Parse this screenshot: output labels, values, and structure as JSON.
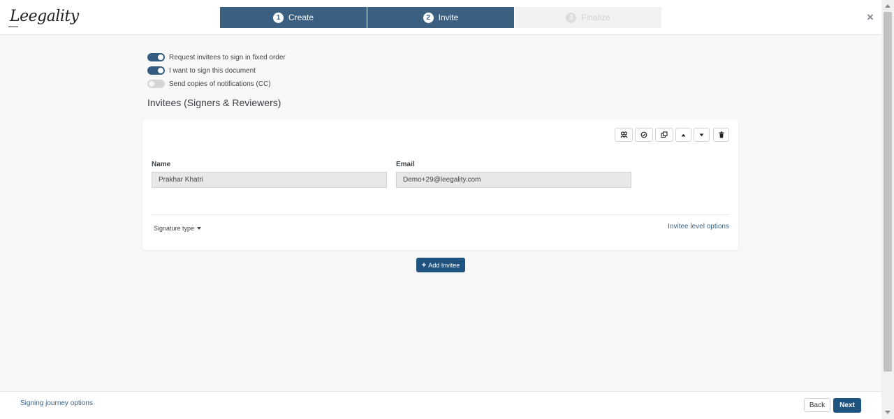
{
  "header": {
    "logo_text": "Leegality",
    "steps": [
      {
        "number": "1",
        "label": "Create",
        "state": "completed"
      },
      {
        "number": "2",
        "label": "Invite",
        "state": "active"
      },
      {
        "number": "3",
        "label": "Finalize",
        "state": "disabled"
      }
    ],
    "close_icon": "×"
  },
  "settings": {
    "toggles": [
      {
        "label": "Request invitees to sign in fixed order",
        "on": true
      },
      {
        "label": "I want to sign this document",
        "on": true
      },
      {
        "label": "Send copies of notifications (CC)",
        "on": false
      }
    ]
  },
  "invitees": {
    "title": "Invitees (Signers & Reviewers)",
    "card": {
      "tools": [
        {
          "name": "group-icon",
          "glyph": "👥"
        },
        {
          "name": "check-circle-icon",
          "glyph": "⊘"
        },
        {
          "name": "copy-icon",
          "glyph": "⧉"
        },
        {
          "name": "move-up-icon",
          "glyph": "▲"
        },
        {
          "name": "move-down-icon",
          "glyph": "▼"
        },
        {
          "name": "trash-icon",
          "glyph": "🗑"
        }
      ],
      "name_label": "Name",
      "name_value": "Prakhar Khatri",
      "email_label": "Email",
      "email_value": "Demo+29@leegality.com",
      "signature_type_label": "Signature type",
      "invitee_options_label": "Invitee level options"
    },
    "add_button_label": "Add Invitee",
    "add_button_icon": "+"
  },
  "footer": {
    "journey_options_label": "Signing journey options",
    "back_label": "Back",
    "next_label": "Next"
  },
  "colors": {
    "primary": "#1f5380",
    "step_active": "#3a5f80",
    "link": "#3a6385"
  }
}
